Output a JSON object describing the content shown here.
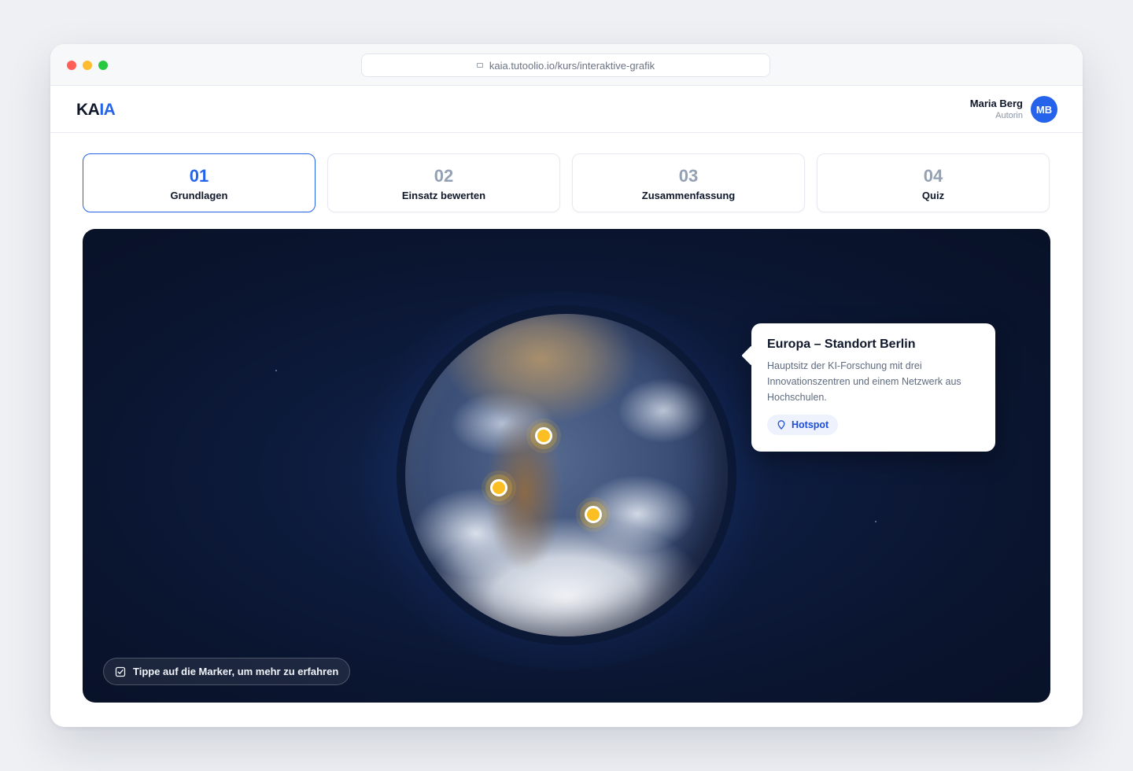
{
  "browser": {
    "url": "kaia.tutoolio.io/kurs/interaktive-grafik"
  },
  "app": {
    "logo_main": "KA",
    "logo_accent": "IA",
    "user": {
      "name": "Maria Berg",
      "role": "Autorin",
      "initials": "MB"
    }
  },
  "steps": [
    {
      "number": "01",
      "label": "Grundlagen",
      "active": true
    },
    {
      "number": "02",
      "label": "Einsatz bewerten",
      "active": false
    },
    {
      "number": "03",
      "label": "Zusammenfassung",
      "active": false
    },
    {
      "number": "04",
      "label": "Quiz",
      "active": false
    }
  ],
  "stage": {
    "popover": {
      "title": "Europa – Standort Berlin",
      "description": "Hauptsitz der KI-Forschung mit drei Innovationszentren und einem Netzwerk aus Hochschulen.",
      "badge": "Hotspot",
      "badge_icon": "map-pin-icon"
    },
    "hint": "Tippe auf die Marker, um mehr zu erfahren",
    "hint_icon": "checkbox-icon",
    "marker_count": 3
  },
  "colors": {
    "accent": "#2563eb",
    "marker": "#fbbf24",
    "stage_bg": "#0a1530"
  }
}
